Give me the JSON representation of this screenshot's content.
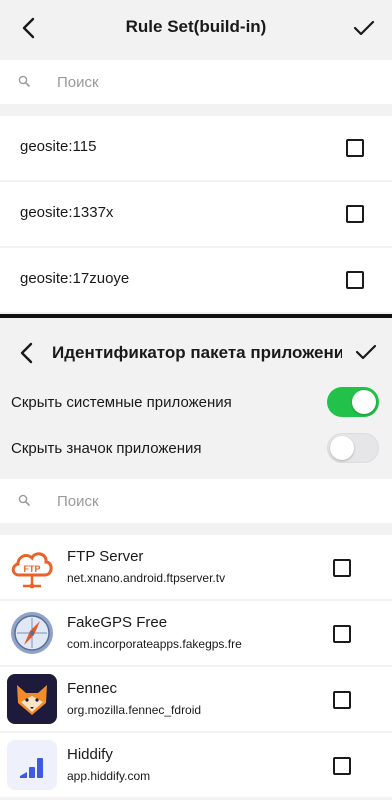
{
  "top": {
    "title": "Rule Set(build-in)",
    "search_placeholder": "Поиск",
    "rules": [
      {
        "label": "geosite:115",
        "checked": false
      },
      {
        "label": "geosite:1337x",
        "checked": false
      },
      {
        "label": "geosite:17zuoye",
        "checked": false
      }
    ]
  },
  "bottom": {
    "title": "Идентификатор пакета приложения",
    "toggles": [
      {
        "label": "Скрыть системные приложения",
        "on": true
      },
      {
        "label": "Скрыть значок приложения",
        "on": false
      }
    ],
    "search_placeholder": "Поиск",
    "apps": [
      {
        "name": "FTP Server",
        "package": "net.xnano.android.ftpserver.tv",
        "icon": "ftp-cloud-icon",
        "checked": false
      },
      {
        "name": "FakeGPS Free",
        "package": "com.incorporateapps.fakegps.fre",
        "icon": "compass-icon",
        "checked": false
      },
      {
        "name": "Fennec",
        "package": "org.mozilla.fennec_fdroid",
        "icon": "fennec-fox-icon",
        "checked": false
      },
      {
        "name": "Hiddify",
        "package": "app.hiddify.com",
        "icon": "hiddify-bars-icon",
        "checked": false
      }
    ],
    "ftp_icon_text": "FTP"
  },
  "colors": {
    "toggle_on": "#22c24a",
    "background": "#f2f2f3",
    "ftp_orange": "#e8622a",
    "fennec_bg": "#1e1a3c",
    "hiddify_blue": "#3d5ae0"
  }
}
